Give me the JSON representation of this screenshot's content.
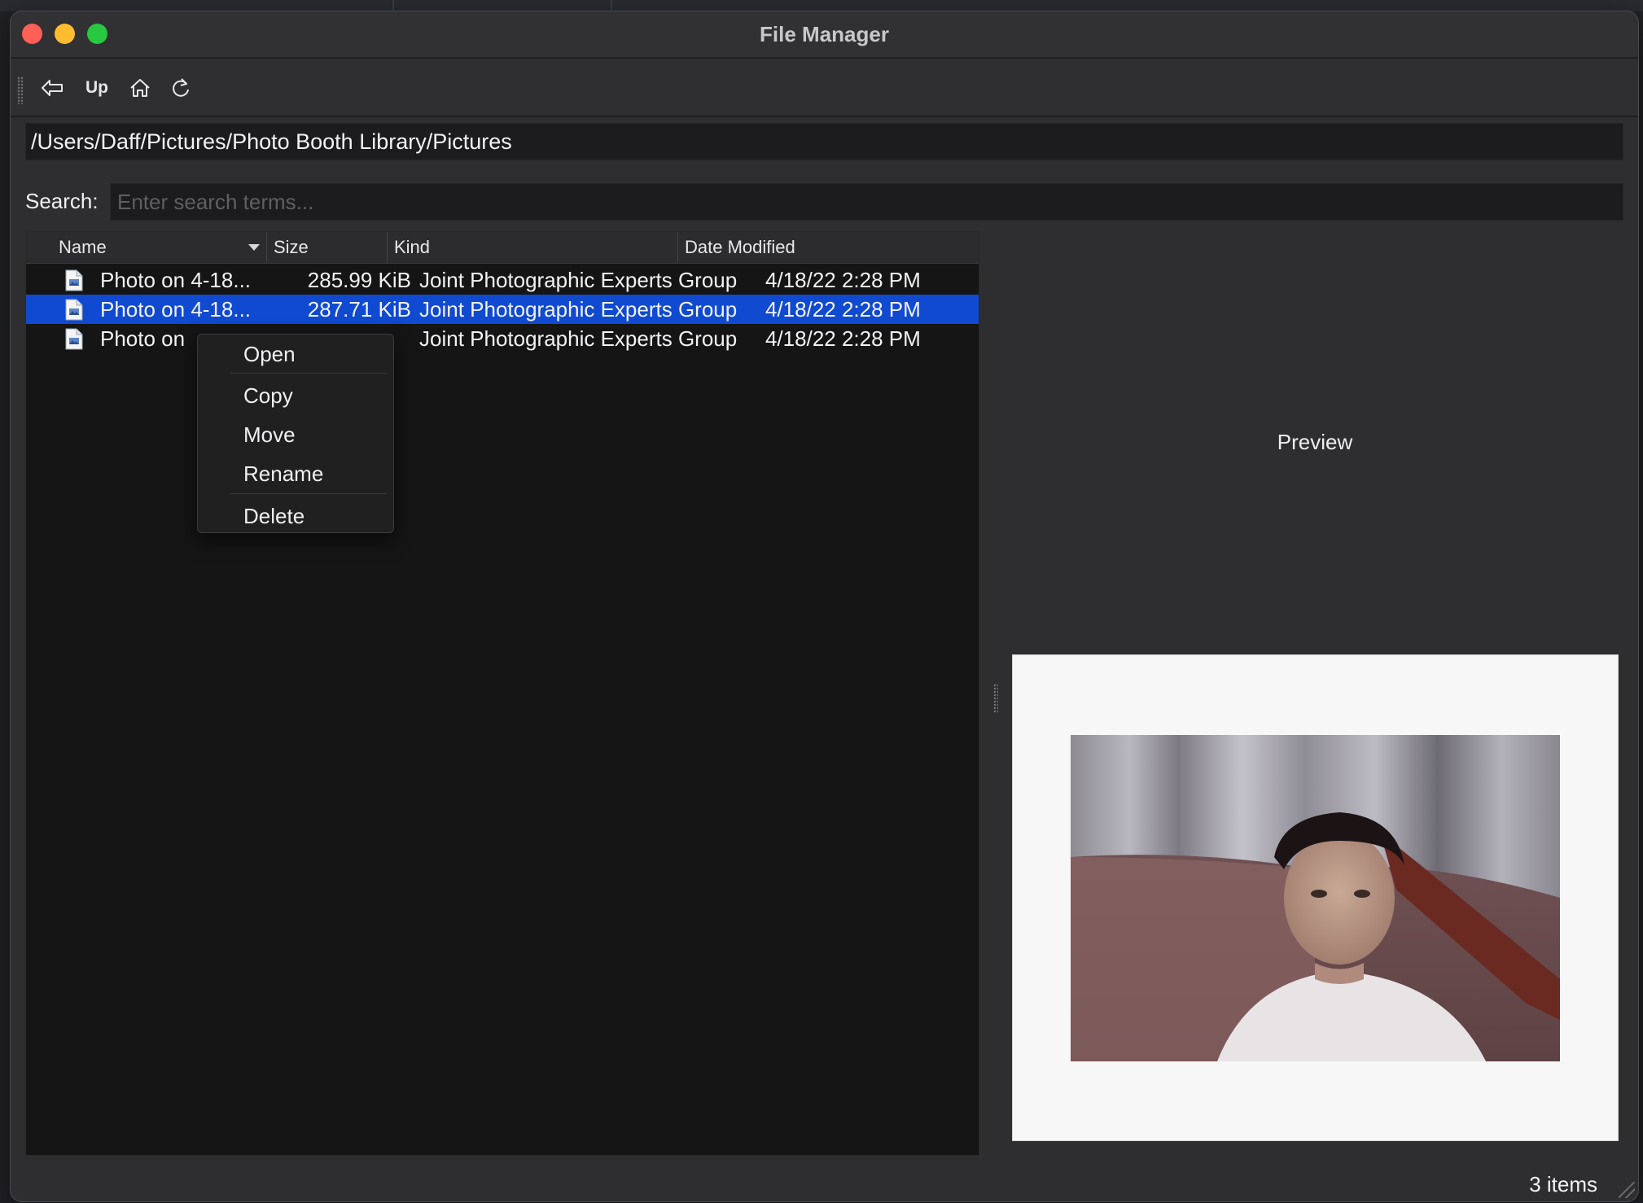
{
  "window": {
    "title": "File Manager"
  },
  "toolbar": {
    "back_icon": "back-arrow-icon",
    "up_label": "Up",
    "home_icon": "home-icon",
    "refresh_icon": "refresh-icon"
  },
  "path": {
    "value": "/Users/Daff/Pictures/Photo Booth Library/Pictures"
  },
  "search": {
    "label": "Search:",
    "placeholder": "Enter search terms..."
  },
  "table": {
    "columns": [
      "Name",
      "Size",
      "Kind",
      "Date Modified"
    ],
    "sort_column": "Name",
    "rows": [
      {
        "name": "Photo on 4-18...",
        "size": "285.99 KiB",
        "kind": "Joint Photographic Experts Group",
        "date": "4/18/22 2:28 PM",
        "icon": "image-file-icon"
      },
      {
        "name": "Photo on 4-18...",
        "size": "287.71 KiB",
        "kind": "Joint Photographic Experts Group",
        "date": "4/18/22 2:28 PM",
        "icon": "image-file-icon"
      },
      {
        "name": "Photo on",
        "size": "",
        "kind": "Joint Photographic Experts Group",
        "date": "4/18/22 2:28 PM",
        "icon": "image-file-icon"
      }
    ],
    "selected_index": 1
  },
  "context_menu": {
    "items": [
      "Open",
      "Copy",
      "Move",
      "Rename",
      "Delete"
    ]
  },
  "preview": {
    "label": "Preview"
  },
  "status": {
    "count": "3 items"
  },
  "colors": {
    "selection": "#0f4ad0",
    "close": "#fe5f57",
    "minimize": "#febc2e",
    "maximize": "#28c840"
  }
}
